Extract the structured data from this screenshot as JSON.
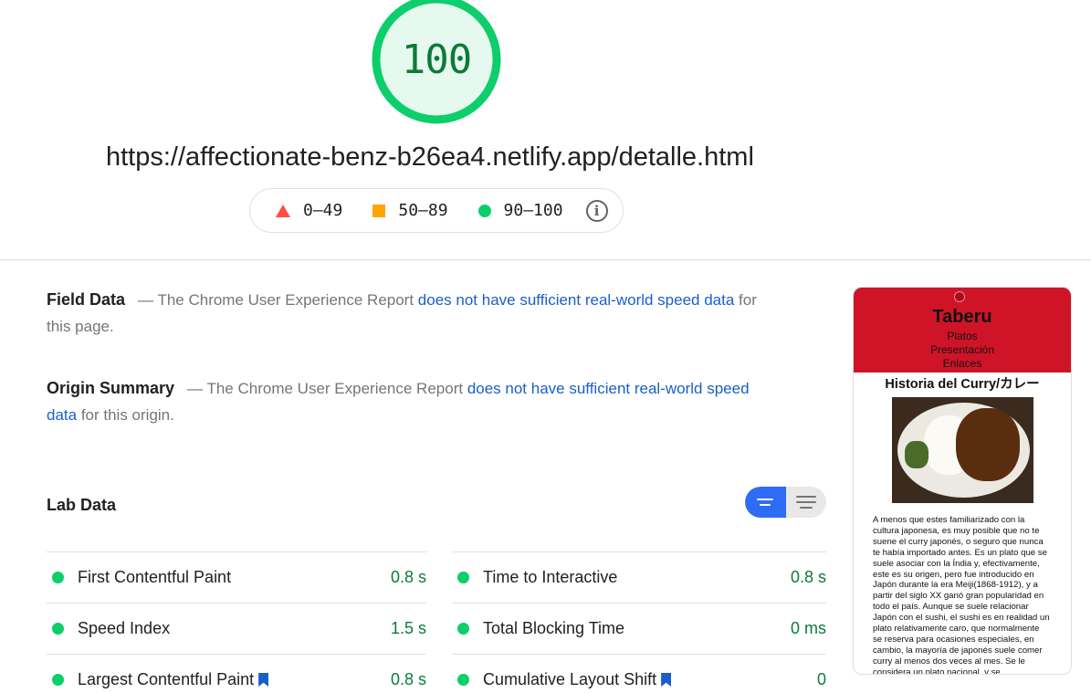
{
  "score": {
    "value": "100",
    "color": "#0cce6b",
    "fill": "#e6f9ef"
  },
  "url": "https://affectionate-benz-b26ea4.netlify.app/detalle.html",
  "legend": [
    {
      "icon": "triangle-icon",
      "label": "0–49",
      "color": "#ff4e42"
    },
    {
      "icon": "square-icon",
      "label": "50–89",
      "color": "#ffa400"
    },
    {
      "icon": "circle-icon",
      "label": "90–100",
      "color": "#0cce6b"
    }
  ],
  "legend_info_icon": "info-icon",
  "field_data": {
    "heading": "Field Data",
    "prefix": "— The Chrome User Experience Report ",
    "link": "does not have sufficient real-world speed data",
    "suffix": " for this page."
  },
  "origin_summary": {
    "heading": "Origin Summary",
    "prefix": "— The Chrome User Experience Report ",
    "link": "does not have sufficient real-world speed data",
    "suffix": " for this origin."
  },
  "lab_data": {
    "title": "Lab Data",
    "metrics_left": [
      {
        "name": "First Contentful Paint",
        "value": "0.8 s",
        "bookmark": false
      },
      {
        "name": "Speed Index",
        "value": "1.5 s",
        "bookmark": false
      },
      {
        "name": "Largest Contentful Paint",
        "value": "0.8 s",
        "bookmark": true
      }
    ],
    "metrics_right": [
      {
        "name": "Time to Interactive",
        "value": "0.8 s",
        "bookmark": false
      },
      {
        "name": "Total Blocking Time",
        "value": "0 ms",
        "bookmark": false
      },
      {
        "name": "Cumulative Layout Shift",
        "value": "0",
        "bookmark": true
      }
    ]
  },
  "colors": {
    "pass": "#0cce6b",
    "link": "#1a5fc9",
    "toggle_active": "#2e6cf5"
  },
  "screenshot": {
    "site_title": "Taberu",
    "nav": [
      "Platos",
      "Presentación",
      "Enlaces"
    ],
    "heading": "Historia del Curry/カレー",
    "body": "A menos que estes familiarizado con la cultura japonesa, es muy posible que no te suene el curry japonés, o seguro que nunca te había importado antes. Es un plato que se suele asociar con la Índia y, efectivamente, este es su origen, pero fue introducido en Japón durante la era Meiji(1868-1912), y a partir del siglo XX ganó gran popularidad en todo el país. Aunque se suele relacionar Japón con el sushi, el sushi es en realidad un plato relativamente caro, que normalmente se reserva para ocasiones especiales, en cambio, la mayoría de japonés suele comer curry al menos dos veces al mes. Se le considera un plato nacional, y se"
  }
}
